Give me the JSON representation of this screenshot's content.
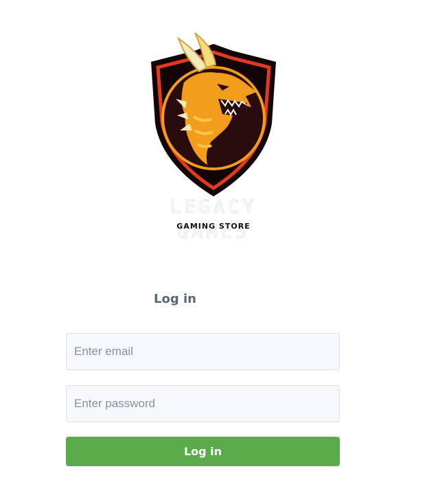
{
  "brand": {
    "title": "LEGACY GAMES",
    "subtitle": "GAMING STORE",
    "colors": {
      "shield_outer": "#120407",
      "shield_red": "#e33a1f",
      "dragon_orange": "#f29d1c",
      "dragon_yellow": "#f8c74a",
      "horn_cream": "#f6e9b8"
    }
  },
  "login": {
    "heading": "Log in",
    "email_placeholder": "Enter email",
    "password_placeholder": "Enter password",
    "button_label": "Log in",
    "button_color": "#5aac4b"
  }
}
